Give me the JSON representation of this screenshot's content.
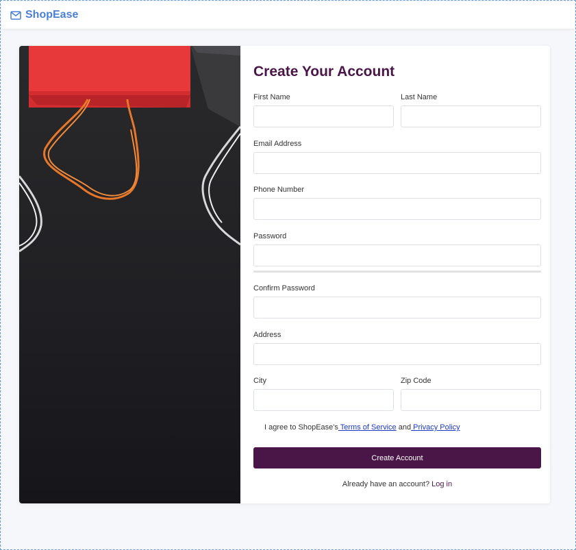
{
  "brand": {
    "name": "ShopEase",
    "icon": "mail-icon",
    "color": "#4a7fd6"
  },
  "form": {
    "title": "Create Your Account",
    "fields": {
      "first_name": {
        "label": "First Name",
        "value": ""
      },
      "last_name": {
        "label": "Last Name",
        "value": ""
      },
      "email": {
        "label": "Email Address",
        "value": ""
      },
      "phone": {
        "label": "Phone Number",
        "value": ""
      },
      "password": {
        "label": "Password",
        "value": ""
      },
      "confirm_password": {
        "label": "Confirm Password",
        "value": ""
      },
      "address": {
        "label": "Address",
        "value": ""
      },
      "city": {
        "label": "City",
        "value": ""
      },
      "zip": {
        "label": "Zip Code",
        "value": ""
      }
    },
    "terms": {
      "prefix": "I agree to ShopEase's",
      "terms_link": " Terms of Service",
      "middle": " and",
      "privacy_link": " Privacy Policy"
    },
    "submit_label": "Create Account",
    "login_prompt": "Already have an account?",
    "login_link": "Log in"
  },
  "colors": {
    "accent": "#4a1547",
    "link": "#1a37c6",
    "brand": "#4a7fd6"
  },
  "hero_image": {
    "subject": "shopping bags on dark background"
  }
}
